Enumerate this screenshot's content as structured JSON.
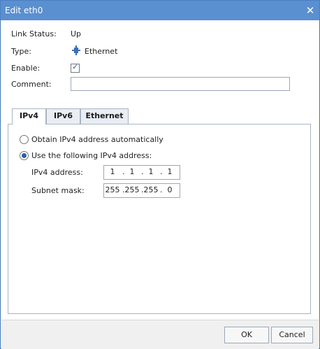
{
  "window": {
    "title": "Edit eth0"
  },
  "fields": {
    "link_status_label": "Link Status:",
    "link_status_value": "Up",
    "type_label": "Type:",
    "type_value": "Ethernet",
    "enable_label": "Enable:",
    "enable_checked": true,
    "comment_label": "Comment:",
    "comment_value": ""
  },
  "tabs": [
    {
      "label": "IPv4",
      "active": true
    },
    {
      "label": "IPv6",
      "active": false
    },
    {
      "label": "Ethernet",
      "active": false
    }
  ],
  "ipv4": {
    "obtain_auto_label": "Obtain IPv4 address automatically",
    "use_following_label": "Use the following IPv4 address:",
    "selected": "use_following",
    "address_label": "IPv4 address:",
    "address": [
      "1",
      "1",
      "1",
      "1"
    ],
    "mask_label": "Subnet mask:",
    "mask": [
      "255",
      "255",
      "255",
      "0"
    ]
  },
  "buttons": {
    "ok": "OK",
    "cancel": "Cancel"
  },
  "colors": {
    "titlebar": "#5a8fd0",
    "accent": "#2d5ea8"
  }
}
